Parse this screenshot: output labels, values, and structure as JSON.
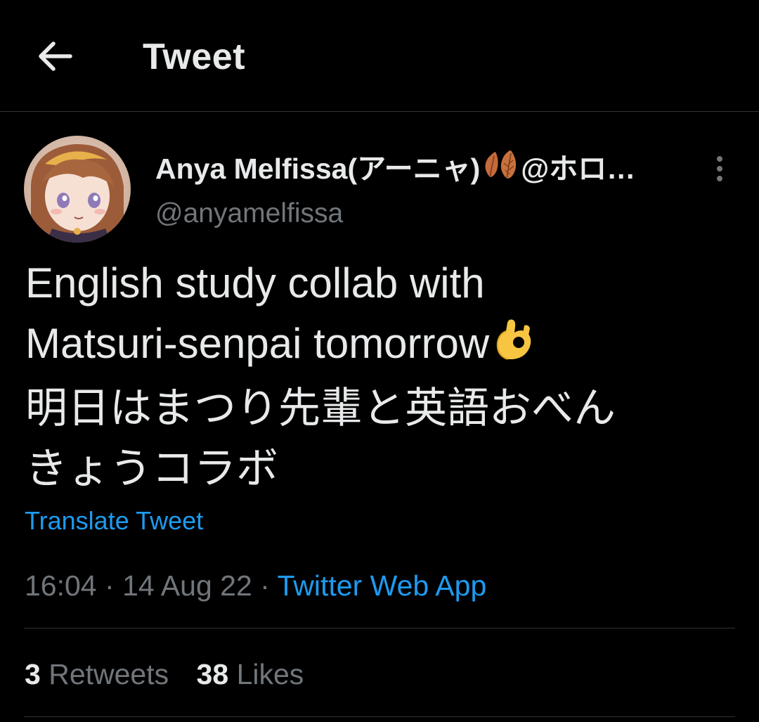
{
  "header": {
    "title": "Tweet",
    "back_icon": "arrow-left-icon"
  },
  "author": {
    "display_name": "Anya Melfissa(アーニャ)",
    "display_name_suffix": "@ホロ…",
    "handle": "@anyamelfissa",
    "name_emoji": "leaf-icon"
  },
  "tweet": {
    "lines": [
      "English study collab with",
      "Matsuri-senpai tomorrow",
      "明日はまつり先輩と英語おべん",
      "きょうコラボ"
    ],
    "emoji": "ok-hand-icon",
    "translate_label": "Translate Tweet",
    "time": "16:04",
    "separator": "·",
    "date": "14 Aug 22",
    "source": "Twitter Web App"
  },
  "stats": {
    "retweets_count": "3",
    "retweets_label": "Retweets",
    "likes_count": "38",
    "likes_label": "Likes"
  },
  "colors": {
    "background": "#000000",
    "text": "#e7e9ea",
    "muted": "#71767b",
    "accent": "#1d9bf0",
    "divider": "#2f3336"
  }
}
